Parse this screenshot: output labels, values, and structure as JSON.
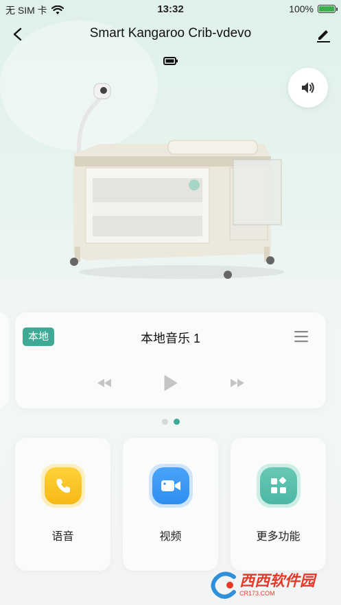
{
  "status_bar": {
    "carrier": "无 SIM 卡",
    "time": "13:32",
    "battery_percent": "100%"
  },
  "nav": {
    "title": "Smart Kangaroo Crib-vdevo"
  },
  "music": {
    "badge": "本地",
    "title": "本地音乐 1"
  },
  "pager": {
    "total": 2,
    "active_index": 1
  },
  "functions": [
    {
      "label": "语音",
      "icon": "phone-icon",
      "color": "#f6b915"
    },
    {
      "label": "视频",
      "icon": "video-camera-icon",
      "color": "#2e8ff0"
    },
    {
      "label": "更多功能",
      "icon": "grid-more-icon",
      "color": "#4db7a3"
    }
  ],
  "watermark": {
    "text": "西西软件园",
    "sub": "CR173.COM"
  },
  "colors": {
    "accent": "#3eaa95",
    "background_top": "#dff1ea"
  }
}
